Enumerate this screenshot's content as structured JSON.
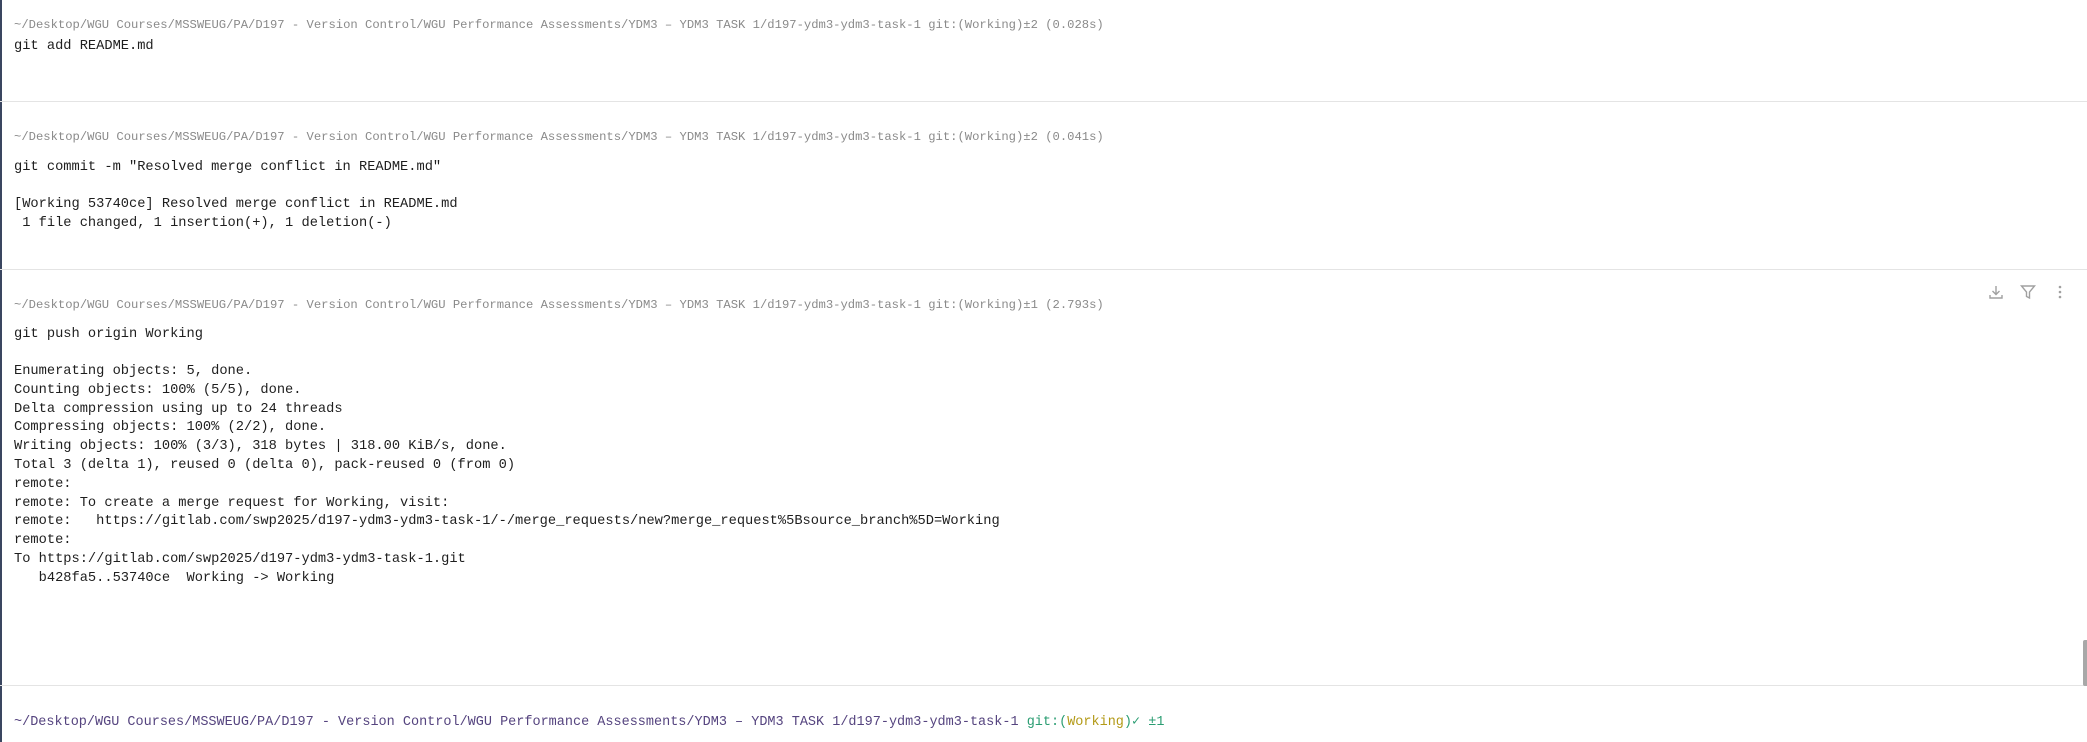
{
  "blocks": [
    {
      "header": "~/Desktop/WGU Courses/MSSWEUG/PA/D197 - Version Control/WGU Performance Assessments/YDM3 – YDM3 TASK 1/d197-ydm3-ydm3-task-1 git:(Working)±2 (0.028s)",
      "command": "git add README.md",
      "output": ""
    },
    {
      "header": "~/Desktop/WGU Courses/MSSWEUG/PA/D197 - Version Control/WGU Performance Assessments/YDM3 – YDM3 TASK 1/d197-ydm3-ydm3-task-1 git:(Working)±2 (0.041s)",
      "command": "git commit -m \"Resolved merge conflict in README.md\"",
      "output": "[Working 53740ce] Resolved merge conflict in README.md\n 1 file changed, 1 insertion(+), 1 deletion(-)"
    },
    {
      "header": "~/Desktop/WGU Courses/MSSWEUG/PA/D197 - Version Control/WGU Performance Assessments/YDM3 – YDM3 TASK 1/d197-ydm3-ydm3-task-1 git:(Working)±1 (2.793s)",
      "command": "git push origin Working",
      "output": "Enumerating objects: 5, done.\nCounting objects: 100% (5/5), done.\nDelta compression using up to 24 threads\nCompressing objects: 100% (2/2), done.\nWriting objects: 100% (3/3), 318 bytes | 318.00 KiB/s, done.\nTotal 3 (delta 1), reused 0 (delta 0), pack-reused 0 (from 0)\nremote:\nremote: To create a merge request for Working, visit:\nremote:   https://gitlab.com/swp2025/d197-ydm3-ydm3-task-1/-/merge_requests/new?merge_request%5Bsource_branch%5D=Working\nremote:\nTo https://gitlab.com/swp2025/d197-ydm3-ydm3-task-1.git\n   b428fa5..53740ce  Working -> Working"
    }
  ],
  "block_icons": [
    "download-icon",
    "filter-icon",
    "more-vertical-icon"
  ],
  "prompt": {
    "path": "~/Desktop/WGU Courses/MSSWEUG/PA/D197 - Version Control/WGU Performance Assessments/YDM3 – YDM3 TASK 1/d197-ydm3-ydm3-task-1",
    "git_prefix": "git:(",
    "branch": "Working",
    "git_suffix": ")",
    "status": "✓ ±1"
  },
  "colors": {
    "path": "#55447f",
    "git": "#2a9d72",
    "branch": "#b39a17"
  }
}
